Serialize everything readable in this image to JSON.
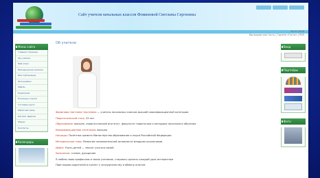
{
  "header": {
    "site_title": "Сайт учителя начальных классов Фоминовой Светланы Сергеевны",
    "info_line1": "20.01.2016",
    "info_line2": "Вы вошли как Гость | Группа «Гости» | RSS"
  },
  "left": {
    "menu_title": "Меню сайта",
    "menu_items": [
      "Главная страница",
      "Об учителе",
      "Мой класс",
      "Методическая копилка",
      "Мои публикации",
      "Фотоальбом",
      "Файлы",
      "Родителям",
      "Полезные ссылки",
      "Гостевая книга",
      "Обратная связь",
      "Каталог файлов",
      "Форум",
      "Контакты"
    ],
    "second_title": "Календарь"
  },
  "main": {
    "heading": "Об учителе",
    "lines": [
      {
        "label": "Фоминова Светлана Сергеевна",
        "text": " — учитель начальных классов высшей квалификационной категории"
      },
      {
        "label": "Педагогический стаж:",
        "text": " 25 лет"
      },
      {
        "label": "Образование:",
        "text": " высшее, педагогический институт, факультет педагогики и методики начального обучения"
      },
      {
        "label": "Квалификационная категория:",
        "text": " высшая"
      },
      {
        "label": "Награды:",
        "text": " Почётная грамота Министерства образования и науки Российской Федерации"
      },
      {
        "label": "Методическая тема:",
        "text": " Развитие познавательной активности младших школьников"
      },
      {
        "label": "Девиз:",
        "text": " Учить детей — значит учиться самой"
      },
      {
        "label": "Увлечения:",
        "text": " чтение, рукоделие"
      },
      {
        "label": "",
        "text": "Я люблю свою профессию и своих учеников, стараюсь сделать каждый урок интересным"
      },
      {
        "label": "",
        "text": "Приглашаю родителей и коллег к сотрудничеству и обмену опытом"
      }
    ]
  },
  "right": {
    "block1_title": "Вход",
    "block2_title": "Партнёры",
    "block3_title": "Фото"
  }
}
